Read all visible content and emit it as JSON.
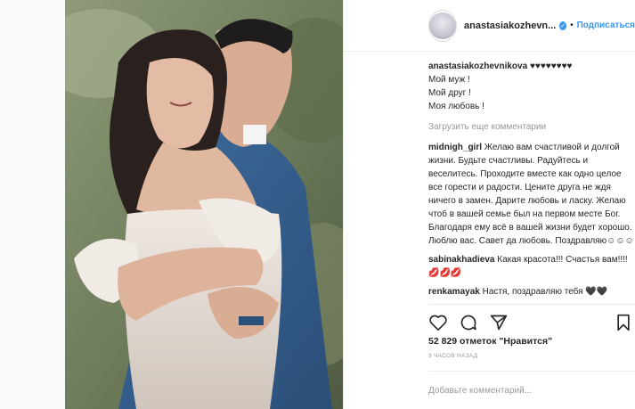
{
  "post": {
    "username": "anastasiakozhevn...",
    "follow_label": "Подписаться",
    "caption": {
      "username": "anastasiakozhevnikova",
      "hearts": "♥♥♥♥♥♥♥♥",
      "lines": [
        "Мой муж !",
        "Мой друг !",
        "Моя любовь !"
      ]
    },
    "load_more": "Загрузить еще комментарии",
    "comments": [
      {
        "username": "midnigh_girl",
        "text": "Желаю вам счастливой и долгой жизни. Будьте счастливы. Радуйтесь и веселитесь. Проходите вместе как одно целое все горести и радости. Цените друга не ждя ничего в замен. Дарите любовь и ласку. Желаю чтоб в вашей семье был на первом месте Бог. Благодаря ему всё в вашей жизни будет хорошо. Люблю вас. Савет да любовь. Поздравляю☺☺☺"
      },
      {
        "username": "sabinakhadieva",
        "text": "Какая красота!!! Счастья вам!!!!💋💋💋"
      },
      {
        "username": "renkamayak",
        "text": "Настя, поздравляю тебя 🖤🖤"
      }
    ],
    "likes": "52 829 отметок \"Нравится\"",
    "time": "9 ЧАСОВ НАЗАД",
    "add_comment_placeholder": "Добавьте комментарий..."
  },
  "colors": {
    "accent": "#3897f0",
    "text": "#262626",
    "muted": "#999999"
  },
  "icons": [
    "heart-icon",
    "comment-icon",
    "share-icon",
    "bookmark-icon",
    "verified-icon"
  ]
}
